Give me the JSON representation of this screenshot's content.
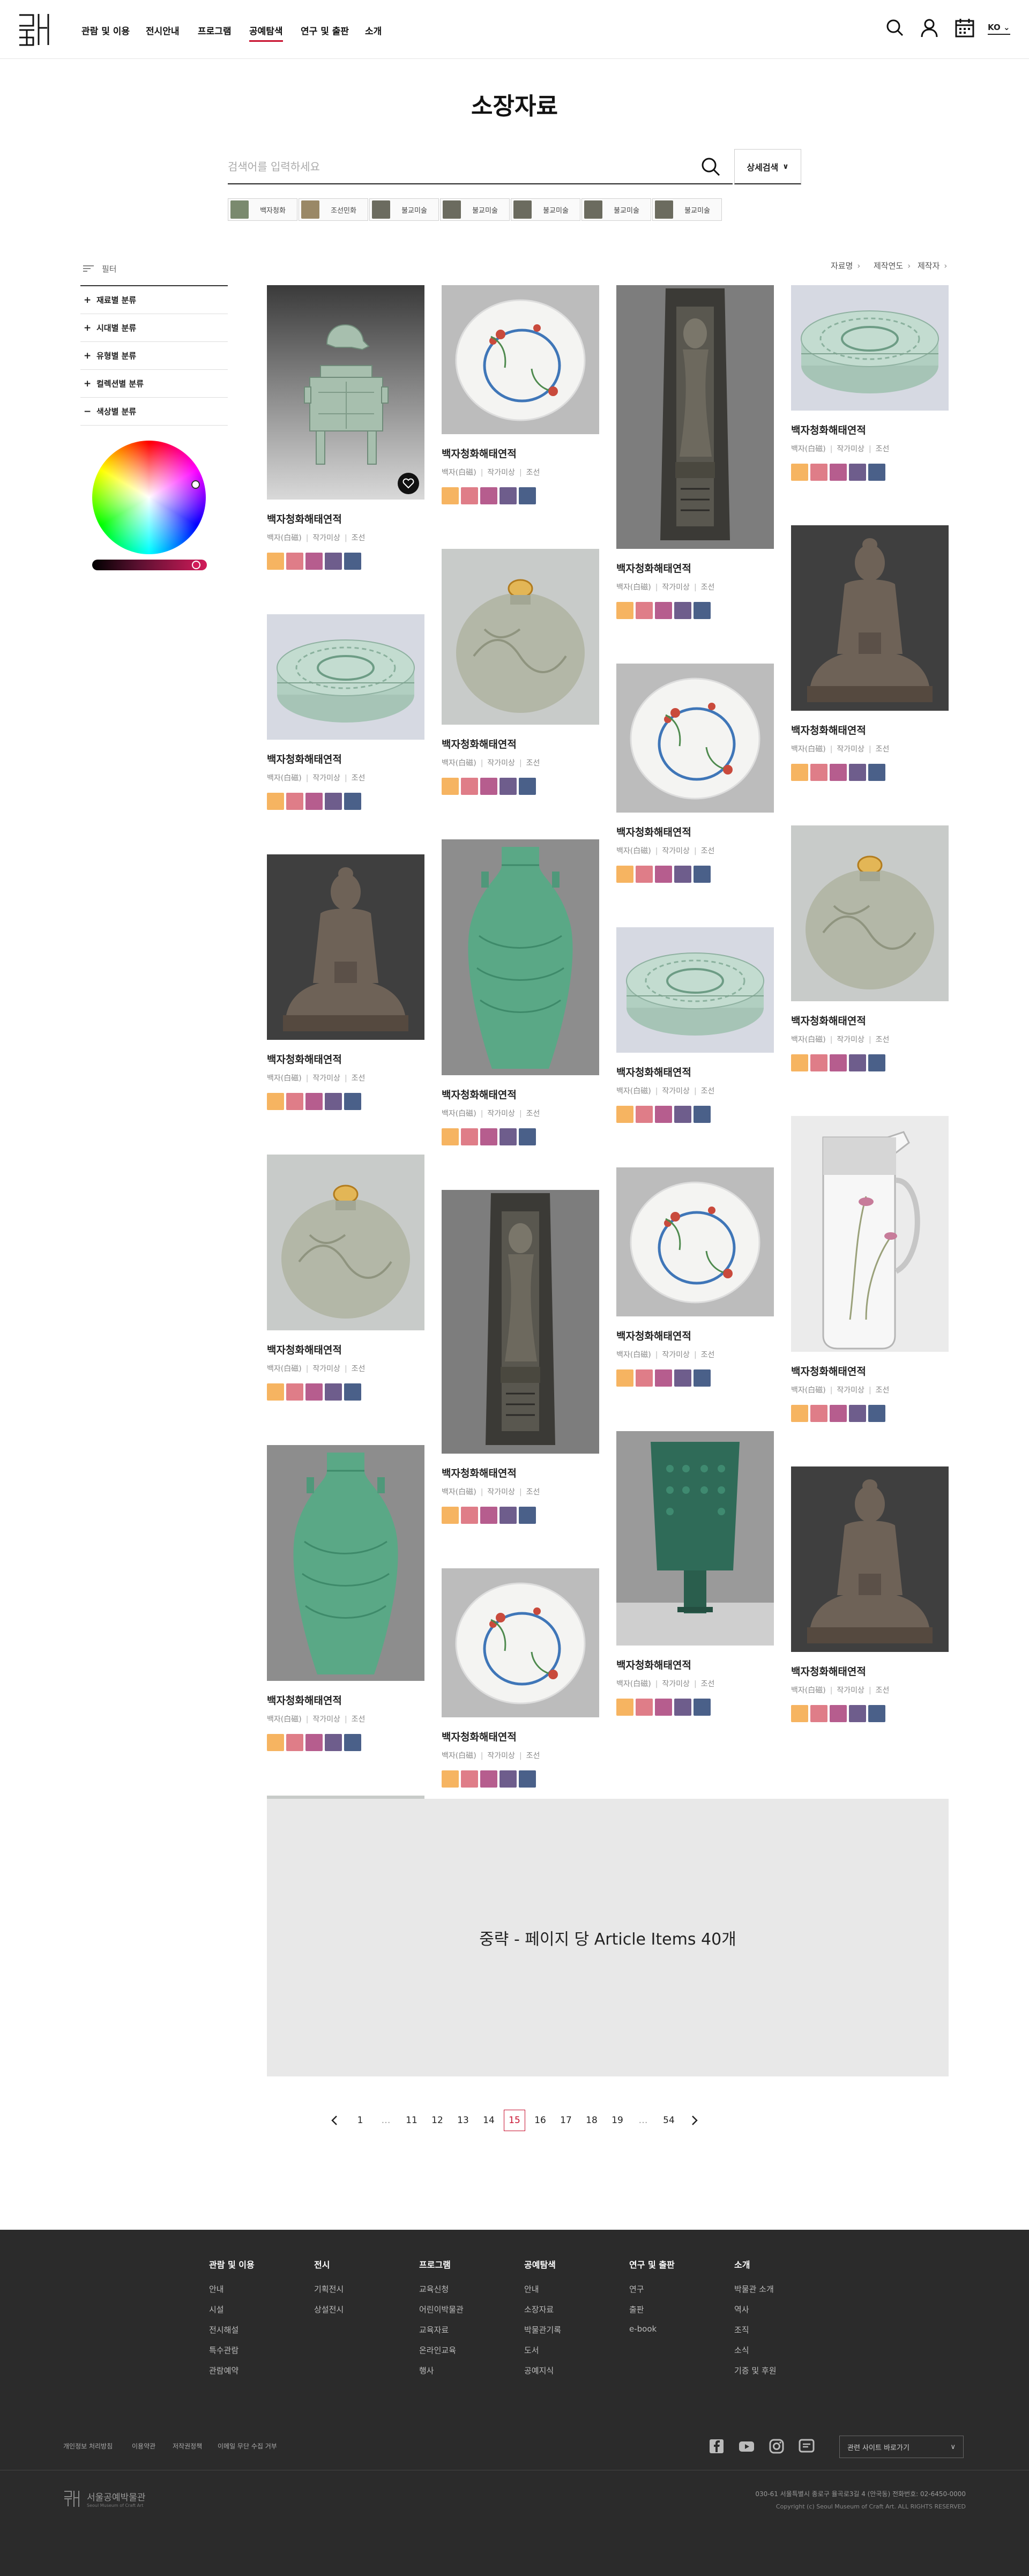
{
  "header": {
    "nav": [
      "관람 및 이용",
      "전시안내",
      "프로그램",
      "공예탐색",
      "연구 및 출판",
      "소개"
    ],
    "active_nav": "공예탐색",
    "lang": "KO"
  },
  "page_title": "소장자료",
  "search": {
    "placeholder": "검색어를 입력하세요",
    "value": "",
    "advanced_label": "상세검색"
  },
  "chips": [
    "백자청화",
    "조선민화",
    "불교미술",
    "불교미술",
    "불교미술",
    "불교미술",
    "불교미술"
  ],
  "sidebar": {
    "filter_label": "필터",
    "sections": [
      {
        "label": "재료별 분류",
        "expanded": false
      },
      {
        "label": "시대별 분류",
        "expanded": false
      },
      {
        "label": "유형별 분류",
        "expanded": false
      },
      {
        "label": "컬렉션별 분류",
        "expanded": false
      },
      {
        "label": "색상별 분류",
        "expanded": true
      }
    ]
  },
  "sort": [
    "자료명",
    "제작연도",
    "제작자"
  ],
  "card_common": {
    "title": "백자청화해태연적",
    "material": "백자(白磁)",
    "maker": "작가미상",
    "period": "조선"
  },
  "swatch_colors": [
    "#f6b461",
    "#df7d88",
    "#b65d8e",
    "#6e5d8c",
    "#4a6089"
  ],
  "cards": [
    {
      "img": "censer"
    },
    {
      "img": "plate"
    },
    {
      "img": "relief"
    },
    {
      "img": "box"
    },
    {
      "img": "box"
    },
    {
      "img": "jar"
    },
    {
      "img": "plate"
    },
    {
      "img": "buddha"
    },
    {
      "img": "buddha"
    },
    {
      "img": "vase"
    },
    {
      "img": "box"
    },
    {
      "img": "jar"
    },
    {
      "img": "jar"
    },
    {
      "img": "relief"
    },
    {
      "img": "plate"
    },
    {
      "img": "pitcher"
    },
    {
      "img": "vase"
    },
    {
      "img": "plate"
    },
    {
      "img": "bell"
    },
    {
      "img": "buddha"
    },
    {
      "img": "jar"
    }
  ],
  "omission_text": "중략 - 페이지 당 Article Items 40개",
  "pagination": {
    "pages": [
      "1",
      "…",
      "11",
      "12",
      "13",
      "14",
      "15",
      "16",
      "17",
      "18",
      "19",
      "…",
      "54"
    ],
    "current": "15"
  },
  "footer": {
    "columns": [
      {
        "title": "관람 및 이용",
        "links": [
          "안내",
          "시설",
          "전시해설",
          "특수관람",
          "관람예약"
        ]
      },
      {
        "title": "전시",
        "links": [
          "기획전시",
          "상설전시"
        ]
      },
      {
        "title": "프로그램",
        "links": [
          "교육신청",
          "어린이박물관",
          "교육자료",
          "온라인교육",
          "행사"
        ]
      },
      {
        "title": "공예탐색",
        "links": [
          "안내",
          "소장자료",
          "박물관기록",
          "도서",
          "공예지식"
        ]
      },
      {
        "title": "연구 및 출판",
        "links": [
          "연구",
          "출판",
          "e-book"
        ]
      },
      {
        "title": "소개",
        "links": [
          "박물관 소개",
          "역사",
          "조직",
          "소식",
          "기증 및 후원"
        ]
      }
    ],
    "bottom_links": [
      "개인정보 처리방침",
      "이용약관",
      "저작권정책",
      "이메일 무단 수집 거부"
    ],
    "family_site": "관련 사이트 바로가기",
    "address": "030-61 서울특별시 종로구 율곡로3길 4 (안국동)  전화번호: 02-6450-0000",
    "copyright": "Copyright (c) Seoul Museum of Craft Art. ALL RIGHTS RESERVED",
    "logo_text": "서울공예박물관",
    "logo_sub": "Seoul Museum of Craft Art"
  }
}
